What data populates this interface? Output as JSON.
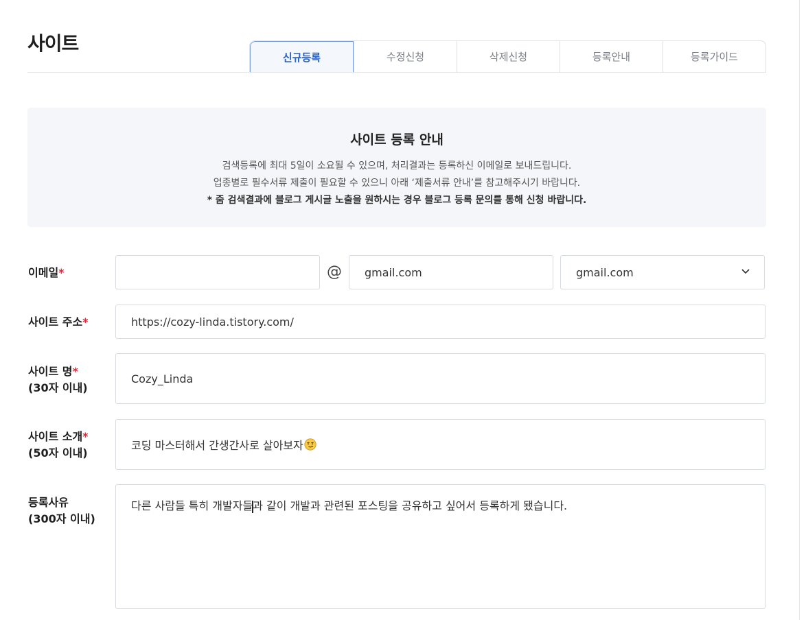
{
  "page": {
    "title": "사이트"
  },
  "tabs": [
    {
      "label": "신규등록",
      "active": true
    },
    {
      "label": "수정신청",
      "active": false
    },
    {
      "label": "삭제신청",
      "active": false
    },
    {
      "label": "등록안내",
      "active": false
    },
    {
      "label": "등록가이드",
      "active": false
    }
  ],
  "notice": {
    "title": "사이트 등록 안내",
    "line1": "검색등록에 최대 5일이 소요될 수 있으며, 처리결과는 등록하신 이메일로 보내드립니다.",
    "line2": "업종별로 필수서류 제출이 필요할 수 있으니 아래 ‘제출서류 안내’를 참고해주시기 바랍니다.",
    "line3": "* 줌 검색결과에 블로그 게시글 노출을 원하시는 경우 블로그 등록 문의를 통해 신청 바랍니다."
  },
  "form": {
    "required_mark": "*",
    "email": {
      "label": "이메일",
      "local_value": "",
      "at": "@",
      "domain_value": "gmail.com",
      "domain_select": "gmail.com"
    },
    "site_url": {
      "label": "사이트 주소",
      "value": "https://cozy-linda.tistory.com/"
    },
    "site_name": {
      "label": "사이트 명",
      "sublabel": "(30자 이내)",
      "value": "Cozy_Linda"
    },
    "site_intro": {
      "label": "사이트 소개",
      "sublabel": "(50자 이내)",
      "value": "코딩 마스터해서 간생간사로 살아보자"
    },
    "reason": {
      "label": "등록사유",
      "sublabel": "(300자 이내)",
      "value_before_caret": "다른 사람들 특히 개발자들",
      "value_after_caret": "과 같이 개발과 관련된 포스팅을 공유하고 싶어서 등록하게 됐습니다."
    }
  },
  "colors": {
    "accent": "#2a62c9",
    "required": "#e0293b",
    "notice_bg": "#f5f6f9"
  },
  "icons": {
    "select_arrow": "chevron-down-icon",
    "emoji": "smirk-emoji-icon"
  }
}
